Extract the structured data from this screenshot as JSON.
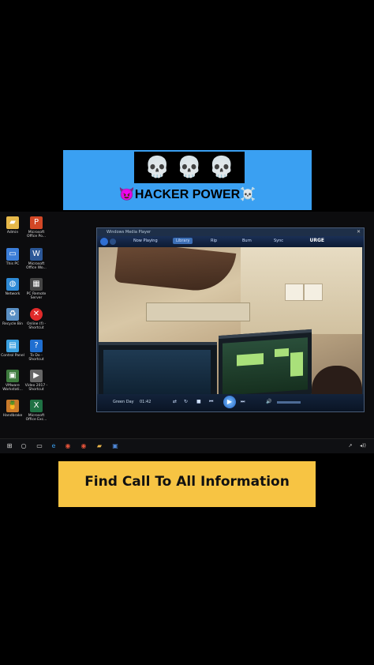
{
  "banner": {
    "skulls": "💀 💀 💀",
    "title": "HACKER POWER",
    "left_emoji": "😈",
    "right_emoji": "☠️"
  },
  "desktop": {
    "icons": [
      {
        "label": "Admin",
        "icon": "folder-icon"
      },
      {
        "label": "Microsoft Office Po...",
        "icon": "powerpoint-icon"
      },
      {
        "label": "This PC",
        "icon": "computer-icon"
      },
      {
        "label": "Microsoft Office Wo...",
        "icon": "word-icon"
      },
      {
        "label": "Network",
        "icon": "network-icon"
      },
      {
        "label": "PC Remote Server",
        "icon": "remote-icon"
      },
      {
        "label": "Recycle Bin",
        "icon": "recycle-bin-icon"
      },
      {
        "label": "Online (f) - Shortcut",
        "icon": "error-icon"
      },
      {
        "label": "Control Panel",
        "icon": "control-panel-icon"
      },
      {
        "label": "To Do - Shortcut",
        "icon": "help-icon"
      },
      {
        "label": "VMware Workstati...",
        "icon": "vmware-icon"
      },
      {
        "label": "Video 2017 - Shortcut",
        "icon": "video-icon"
      },
      {
        "label": "Handbrake",
        "icon": "handbrake-icon"
      },
      {
        "label": "Microsoft Office Exc...",
        "icon": "excel-icon"
      }
    ]
  },
  "wmp": {
    "window_title": "Windows Media Player",
    "tabs": [
      "Now Playing",
      "Library",
      "Rip",
      "Burn",
      "Sync"
    ],
    "active_tab": "Library",
    "brand": "URGE",
    "now_playing": "Green Day",
    "time": "01:42"
  },
  "taskbar": {
    "items": [
      "start-icon",
      "search-icon",
      "task-view-icon",
      "edge-icon",
      "chrome-icon",
      "chrome-alt-icon",
      "file-explorer-icon",
      "media-player-icon"
    ]
  },
  "cta": {
    "text": "Find Call To All Information"
  },
  "colors": {
    "banner_bg": "#3aa0f2",
    "cta_bg": "#f7c443",
    "page_bg": "#000000"
  }
}
